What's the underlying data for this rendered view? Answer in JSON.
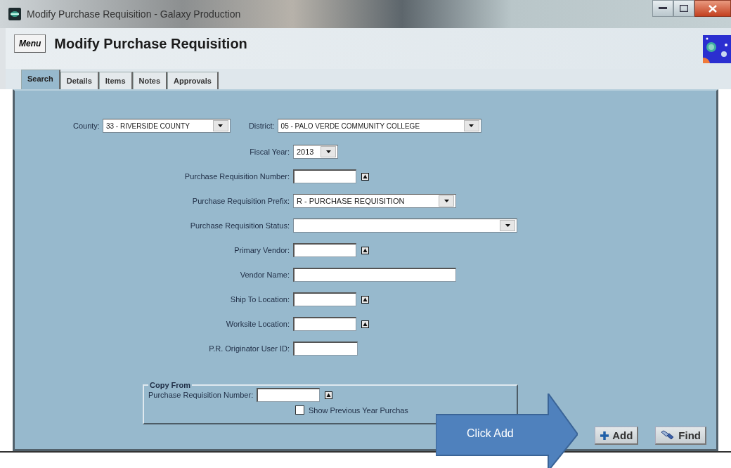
{
  "window": {
    "title": "Modify Purchase Requisition - Galaxy Production"
  },
  "menu_button": "Menu",
  "heading": "Modify Purchase Requisition",
  "tabs": [
    {
      "label": "Search",
      "selected": true
    },
    {
      "label": "Details",
      "selected": false
    },
    {
      "label": "Items",
      "selected": false
    },
    {
      "label": "Notes",
      "selected": false
    },
    {
      "label": "Approvals",
      "selected": false
    }
  ],
  "county": {
    "label": "County:",
    "value": "33 - RIVERSIDE COUNTY"
  },
  "district": {
    "label": "District:",
    "value": "05 - PALO VERDE COMMUNITY COLLEGE"
  },
  "fields": [
    {
      "kind": "dropdown",
      "label": "Fiscal Year:",
      "value": "2013"
    },
    {
      "kind": "lookup",
      "label": "Purchase Requisition Number:"
    },
    {
      "kind": "dropdown",
      "label": "Purchase Requisition Prefix:",
      "value": "R - PURCHASE REQUISITION"
    },
    {
      "kind": "dropdown",
      "label": "Purchase Requisition Status:"
    },
    {
      "kind": "lookup",
      "label": "Primary Vendor:"
    },
    {
      "kind": "text",
      "label": "Vendor Name:"
    },
    {
      "kind": "lookup",
      "label": "Ship To Location:"
    },
    {
      "kind": "lookup",
      "label": "Worksite Location:"
    },
    {
      "kind": "text",
      "label": "P.R. Originator User ID:"
    }
  ],
  "copy_from": {
    "title": "Copy From",
    "field": {
      "label": "Purchase Requisition Number:"
    },
    "checkbox": {
      "label": "Show Previous Year Purchas",
      "checked": false
    }
  },
  "buttons": [
    {
      "kind": "add",
      "label": "Add"
    },
    {
      "kind": "find",
      "label": "Find"
    }
  ],
  "callout": {
    "text": "Click Add"
  }
}
